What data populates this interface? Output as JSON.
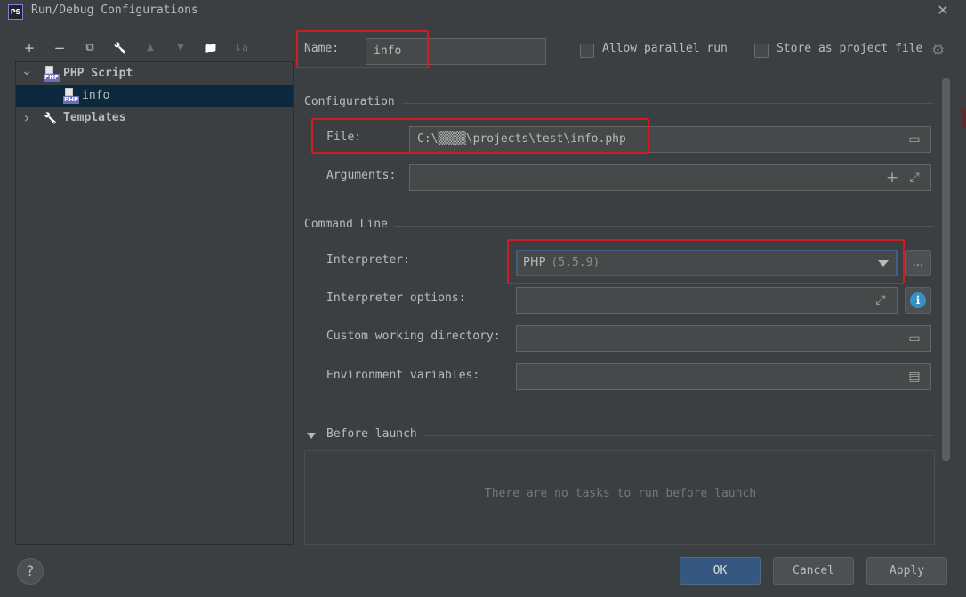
{
  "window": {
    "app_icon_text": "PS",
    "title": "Run/Debug Configurations",
    "close_glyph": "✕"
  },
  "toolbar": {
    "items": [
      {
        "name": "add-icon",
        "glyph": "+"
      },
      {
        "name": "remove-icon",
        "glyph": "−"
      },
      {
        "name": "copy-icon",
        "glyph": "⧉"
      },
      {
        "name": "wrench-icon",
        "glyph": "🔧"
      },
      {
        "name": "move-up-icon",
        "glyph": "▲"
      },
      {
        "name": "move-down-icon",
        "glyph": "▼"
      },
      {
        "name": "new-folder-icon",
        "glyph": "📁"
      },
      {
        "name": "sort-icon",
        "glyph": "↓a"
      }
    ]
  },
  "tree": {
    "php_icon_label": "PHP",
    "php_script": "PHP Script",
    "info": "info",
    "templates": "Templates",
    "expanded_chevron": "⌄",
    "collapsed_chevron": "›"
  },
  "form": {
    "name_label": "Name:",
    "name_value": "info",
    "allow_parallel": "Allow parallel run",
    "store_project": "Store as project file",
    "configuration_section": "Configuration",
    "file_label": "File:",
    "file_value": "C:\\▒▒▒▒\\projects\\test\\info.php",
    "arguments_label": "Arguments:",
    "arguments_value": "",
    "command_line_section": "Command Line",
    "interpreter_label": "Interpreter:",
    "interpreter_name": "PHP",
    "interpreter_version": "(5.5.9)",
    "interpreter_options_label": "Interpreter options:",
    "working_dir_label": "Custom working directory:",
    "env_vars_label": "Environment variables:",
    "before_launch_section": "Before launch",
    "before_launch_empty": "There are no tasks to run before launch",
    "ellipsis": "...",
    "info_glyph": "i"
  },
  "buttons": {
    "ok": "OK",
    "cancel": "Cancel",
    "apply": "Apply",
    "help": "?"
  },
  "colors": {
    "highlight_red": "#d01c24",
    "selection": "#0d293e",
    "primary_button": "#365880",
    "background": "#3c3f41"
  }
}
